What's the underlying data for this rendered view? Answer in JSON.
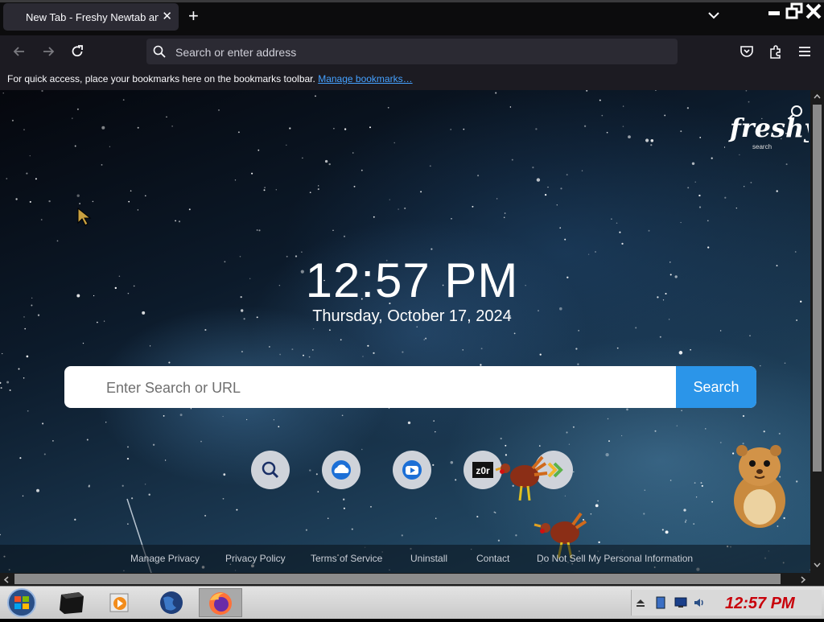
{
  "browser": {
    "tab_title": "New Tab - Freshy Newtab and",
    "address_placeholder": "Search or enter address",
    "bookmarks_text": "For quick access, place your bookmarks here on the bookmarks toolbar.",
    "bookmarks_link": "Manage bookmarks…"
  },
  "page": {
    "logo_text": "freshy",
    "logo_sub": "search",
    "clock": "12:57 PM",
    "date": "Thursday, October 17, 2024",
    "search_placeholder": "Enter Search or URL",
    "search_button": "Search",
    "quick_links": [
      {
        "icon": "search-icon"
      },
      {
        "icon": "cloud-upload-icon"
      },
      {
        "icon": "video-play-icon"
      },
      {
        "icon": "z0r-icon",
        "text": "z0r"
      },
      {
        "icon": "forward-arrows-icon"
      }
    ],
    "footer_links": [
      "Manage Privacy",
      "Privacy Policy",
      "Terms of Service",
      "Uninstall",
      "Contact",
      "Do Not Sell My Personal Information"
    ]
  },
  "taskbar": {
    "time": "12:57 PM"
  },
  "colors": {
    "search_button": "#2b95e9",
    "tray_time": "#c8000a",
    "link": "#45a1ff"
  }
}
